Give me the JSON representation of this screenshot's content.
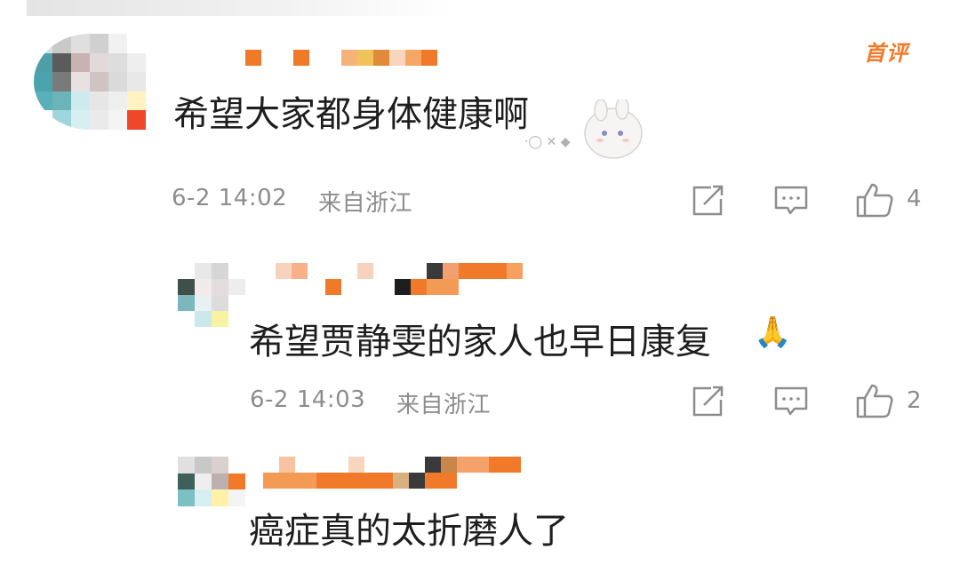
{
  "comments": [
    {
      "badge": "首评",
      "text": "希望大家都身体健康啊",
      "date": "6-2 14:02",
      "location": "来自浙江",
      "likes": "4"
    },
    {
      "text": "希望贾静雯的家人也早日康复",
      "emoji": "🙏",
      "date": "6-2 14:03",
      "location": "来自浙江",
      "likes": "2"
    },
    {
      "text": "癌症真的太折磨人了"
    }
  ],
  "icons": {
    "share": "share-icon",
    "reply": "comment-icon",
    "like": "thumbs-up-icon"
  },
  "colors": {
    "meta": "#8d8d8d",
    "badge": "#f07a2a",
    "name_mosaic": "#f07a2a"
  }
}
